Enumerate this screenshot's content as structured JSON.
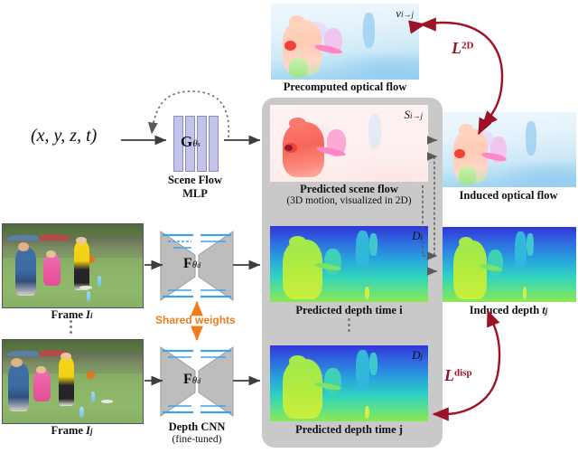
{
  "figure": {
    "title": "Scene flow and depth prediction pipeline",
    "domain": "diagram"
  },
  "colors": {
    "loss_red": "#9c1226",
    "shared_orange": "#f07d1c",
    "panel_gray": "#c9c9c9",
    "mlp_bar": "#c3c4ea",
    "cnn_gray": "#b8b8b8",
    "cnn_blue": "#4aa3e8",
    "arrow_dark": "#444444"
  },
  "input": {
    "coords_label": "(x, y, z, t)"
  },
  "scene_flow_mlp": {
    "symbol": "G",
    "symbol_sub": "θ",
    "symbol_sub2": "s",
    "caption_line1": "Scene Flow",
    "caption_line2": "MLP",
    "bar_count": 4
  },
  "depth_cnn": {
    "symbol": "F",
    "symbol_sub": "θ",
    "symbol_sub2": "d",
    "caption_line1": "Depth CNN",
    "caption_line2": "(fine-tuned)",
    "shared_weights_label": "Shared weights"
  },
  "panels": {
    "precomputed_optical_flow": {
      "caption": "Precomputed optical flow",
      "symbol": "v",
      "symbol_sub": "i→j",
      "type": "optical-flow-visualization"
    },
    "predicted_scene_flow": {
      "caption": "Predicted scene flow",
      "subcaption": "(3D motion, visualized in 2D)",
      "symbol": "S",
      "symbol_sub": "i→j",
      "type": "scene-flow-visualization"
    },
    "induced_optical_flow": {
      "caption": "Induced optical flow",
      "type": "optical-flow-visualization"
    },
    "predicted_depth_i": {
      "caption": "Predicted depth time i",
      "symbol": "D",
      "symbol_sub": "i",
      "type": "depth-map"
    },
    "predicted_depth_j": {
      "caption": "Predicted depth time j",
      "symbol": "D",
      "symbol_sub": "j",
      "type": "depth-map"
    },
    "induced_depth": {
      "caption_pre": "Induced depth ",
      "caption_sym": "t",
      "caption_sub": "j",
      "type": "depth-map"
    },
    "frame_i": {
      "caption_pre": "Frame ",
      "caption_sym": "I",
      "caption_sub": "i",
      "type": "rgb-photo"
    },
    "frame_j": {
      "caption_pre": "Frame ",
      "caption_sym": "I",
      "caption_sub": "j",
      "type": "rgb-photo"
    }
  },
  "losses": {
    "loss_2d": {
      "symbol": "L",
      "superscript": "2D"
    },
    "loss_disp": {
      "symbol": "L",
      "superscript": "disp"
    }
  }
}
